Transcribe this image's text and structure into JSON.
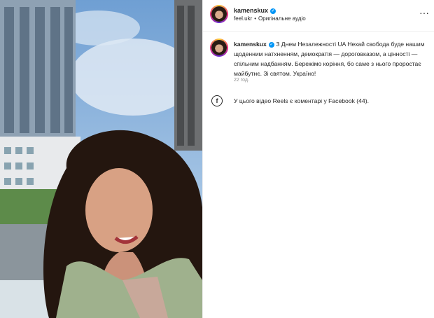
{
  "post": {
    "username": "kamenskux",
    "audio_account": "feel.ukr",
    "audio_separator": "•",
    "audio_label": "Оригінальне аудіо",
    "more_glyph": "···"
  },
  "caption": {
    "username": "kamenskux",
    "text": "З Днем Незалежності UA Нехай свобода буде нашим щоденним натхненням, демократія — дороговказом, а цінності — спільним надбанням. Бережімо коріння, бо саме з нього проростає майбутнє. Зі святом. Україно!",
    "time": "22 год."
  },
  "facebook_note": {
    "text": "У цього відео Reels є коментарі у Facebook (44)."
  },
  "colors": {
    "verified": "#0095f6",
    "text": "#262626",
    "muted": "#8e8e8e"
  }
}
